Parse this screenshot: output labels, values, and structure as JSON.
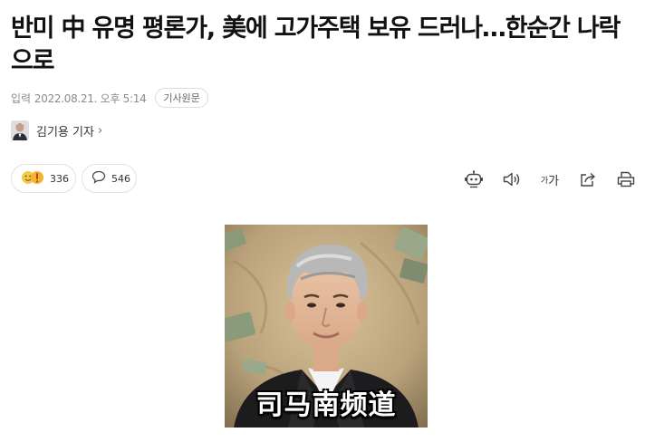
{
  "article": {
    "headline": "반미 中 유명 평론가, 美에 고가주택 보유 드러나…한순간 나락으로",
    "date_label": "입력",
    "date": "2022.08.21. 오후 5:14",
    "origin_button": "기사원문",
    "reporter": "김기용 기자"
  },
  "reactions": {
    "reaction_count": "336",
    "comment_count": "546"
  },
  "toolbar": {
    "icons": [
      "robot-summary-icon",
      "speaker-icon",
      "font-size-icon",
      "share-icon",
      "print-icon"
    ],
    "font_size_small": "가",
    "font_size_large": "가"
  },
  "photo": {
    "logo_text": "司马南频道"
  },
  "colors": {
    "photo_bg": "#b9a27a",
    "suit": "#1c1c1e"
  }
}
